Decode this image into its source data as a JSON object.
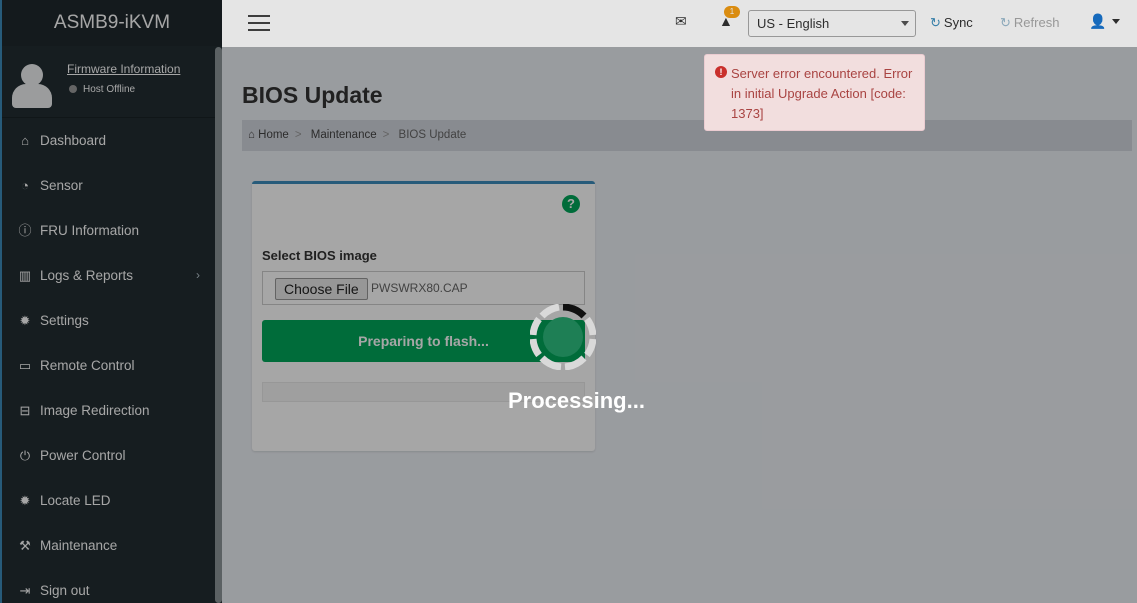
{
  "app": {
    "title": "ASMB9-iKVM"
  },
  "user_panel": {
    "firmware_link": "Firmware Information",
    "host_status": "Host Offline"
  },
  "sidebar": {
    "items": [
      {
        "label": "Dashboard",
        "icon": "home-icon"
      },
      {
        "label": "Sensor",
        "icon": "dashboard-gauge-icon"
      },
      {
        "label": "FRU Information",
        "icon": "info-icon"
      },
      {
        "label": "Logs & Reports",
        "icon": "bar-chart-icon"
      },
      {
        "label": "Settings",
        "icon": "gear-icon"
      },
      {
        "label": "Remote Control",
        "icon": "monitor-icon"
      },
      {
        "label": "Image Redirection",
        "icon": "hdd-icon"
      },
      {
        "label": "Power Control",
        "icon": "power-icon"
      },
      {
        "label": "Locate LED",
        "icon": "gear-icon"
      },
      {
        "label": "Maintenance",
        "icon": "wrench-icon"
      },
      {
        "label": "Sign out",
        "icon": "sign-out-icon"
      }
    ]
  },
  "header": {
    "notification_count": "1",
    "language": "US - English",
    "sync_label": "Sync",
    "refresh_label": "Refresh"
  },
  "error": {
    "message": "Server error encountered. Error in initial Upgrade Action [code: 1373]"
  },
  "page": {
    "title": "BIOS Update",
    "breadcrumb": {
      "home": "Home",
      "section": "Maintenance",
      "current": "BIOS Update"
    }
  },
  "form": {
    "label": "Select BIOS image",
    "choose_file_label": "Choose File",
    "file_name": "PWSWRX80.CAP",
    "flash_button": "Preparing to flash..."
  },
  "overlay": {
    "text": "Processing..."
  },
  "colors": {
    "sidebar": "#222d32",
    "accent": "#3c8dbc",
    "success": "#00a65a",
    "error": "#a94442"
  }
}
